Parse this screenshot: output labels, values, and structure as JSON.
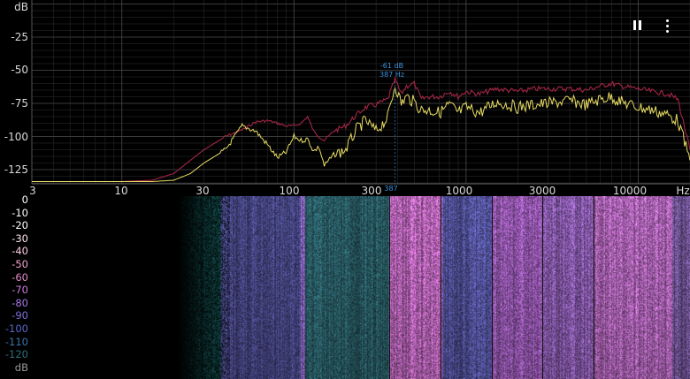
{
  "spectrum": {
    "y_unit": "dB",
    "y_ticks": [
      "-25",
      "-50",
      "-75",
      "-100",
      "-125"
    ],
    "x_ticks": [
      "3",
      "10",
      "30",
      "100",
      "300",
      "1000",
      "3000",
      "10000"
    ],
    "x_unit": "Hz",
    "peak": {
      "db_label": "-61 dB",
      "hz_label": "387 Hz",
      "axis_label": "387"
    },
    "colors": {
      "grid": "#2f2f2f",
      "live_trace": "#e8dc63",
      "peak_hold_trace": "#a32545",
      "peak_text": "#3a92df"
    }
  },
  "controls": {
    "pause_icon": "pause-icon",
    "menu_icon": "more-vert-icon"
  },
  "spectrogram": {
    "scale_labels": [
      "0",
      "-10",
      "-20",
      "-30",
      "-40",
      "-50",
      "-60",
      "-70",
      "-80",
      "-90",
      "-100",
      "-110",
      "-120",
      "dB"
    ],
    "scale_colors": [
      "#ffffff",
      "#ffffff",
      "#ffffff",
      "#ffe4f0",
      "#f8c8e0",
      "#f0a4c8",
      "#e089c8",
      "#c97ad8",
      "#a57ae0",
      "#8070d8",
      "#5c66c8",
      "#3b74a8",
      "#2e6f78",
      "#9a9a9a"
    ]
  },
  "chart_data": {
    "type": "line",
    "title": "",
    "xlabel": "Hz",
    "ylabel": "dB",
    "x_scale": "log",
    "xlim": [
      3,
      20000
    ],
    "ylim": [
      -135,
      0
    ],
    "grid": true,
    "series": [
      {
        "color": "#a32545",
        "x": [
          3,
          10,
          15,
          20,
          25,
          30,
          40,
          50,
          60,
          70,
          80,
          90,
          100,
          110,
          120,
          130,
          140,
          150,
          170,
          200,
          230,
          260,
          300,
          350,
          387,
          420,
          450,
          500,
          550,
          600,
          700,
          800,
          900,
          1000,
          1200,
          1500,
          2000,
          2500,
          3000,
          4000,
          5000,
          6000,
          7000,
          8000,
          10000,
          12000,
          15000,
          17000,
          20000
        ],
        "y": [
          -134,
          -134,
          -133,
          -128,
          -118,
          -110,
          -100,
          -95,
          -89,
          -88,
          -90,
          -92,
          -92,
          -90,
          -85,
          -96,
          -100,
          -103,
          -96,
          -92,
          -84,
          -78,
          -76,
          -72,
          -57,
          -68,
          -62,
          -60,
          -72,
          -70,
          -70,
          -66,
          -70,
          -66,
          -68,
          -64,
          -66,
          -64,
          -64,
          -64,
          -65,
          -62,
          -60,
          -62,
          -64,
          -66,
          -68,
          -72,
          -110
        ]
      },
      {
        "color": "#e8dc63",
        "x": [
          3,
          10,
          15,
          20,
          25,
          30,
          40,
          50,
          60,
          70,
          80,
          90,
          100,
          110,
          120,
          130,
          140,
          150,
          170,
          200,
          230,
          260,
          300,
          350,
          387,
          420,
          450,
          500,
          550,
          600,
          700,
          800,
          900,
          1000,
          1200,
          1500,
          2000,
          2500,
          3000,
          4000,
          5000,
          6000,
          7000,
          8000,
          10000,
          12000,
          15000,
          17000,
          20000
        ],
        "y": [
          -134,
          -134,
          -134,
          -133,
          -128,
          -120,
          -110,
          -92,
          -96,
          -106,
          -116,
          -112,
          -100,
          -103,
          -102,
          -111,
          -108,
          -122,
          -114,
          -110,
          -95,
          -88,
          -96,
          -86,
          -61,
          -75,
          -70,
          -74,
          -80,
          -80,
          -82,
          -76,
          -82,
          -78,
          -82,
          -74,
          -78,
          -76,
          -75,
          -73,
          -76,
          -72,
          -70,
          -74,
          -78,
          -80,
          -84,
          -88,
          -118
        ]
      }
    ]
  }
}
